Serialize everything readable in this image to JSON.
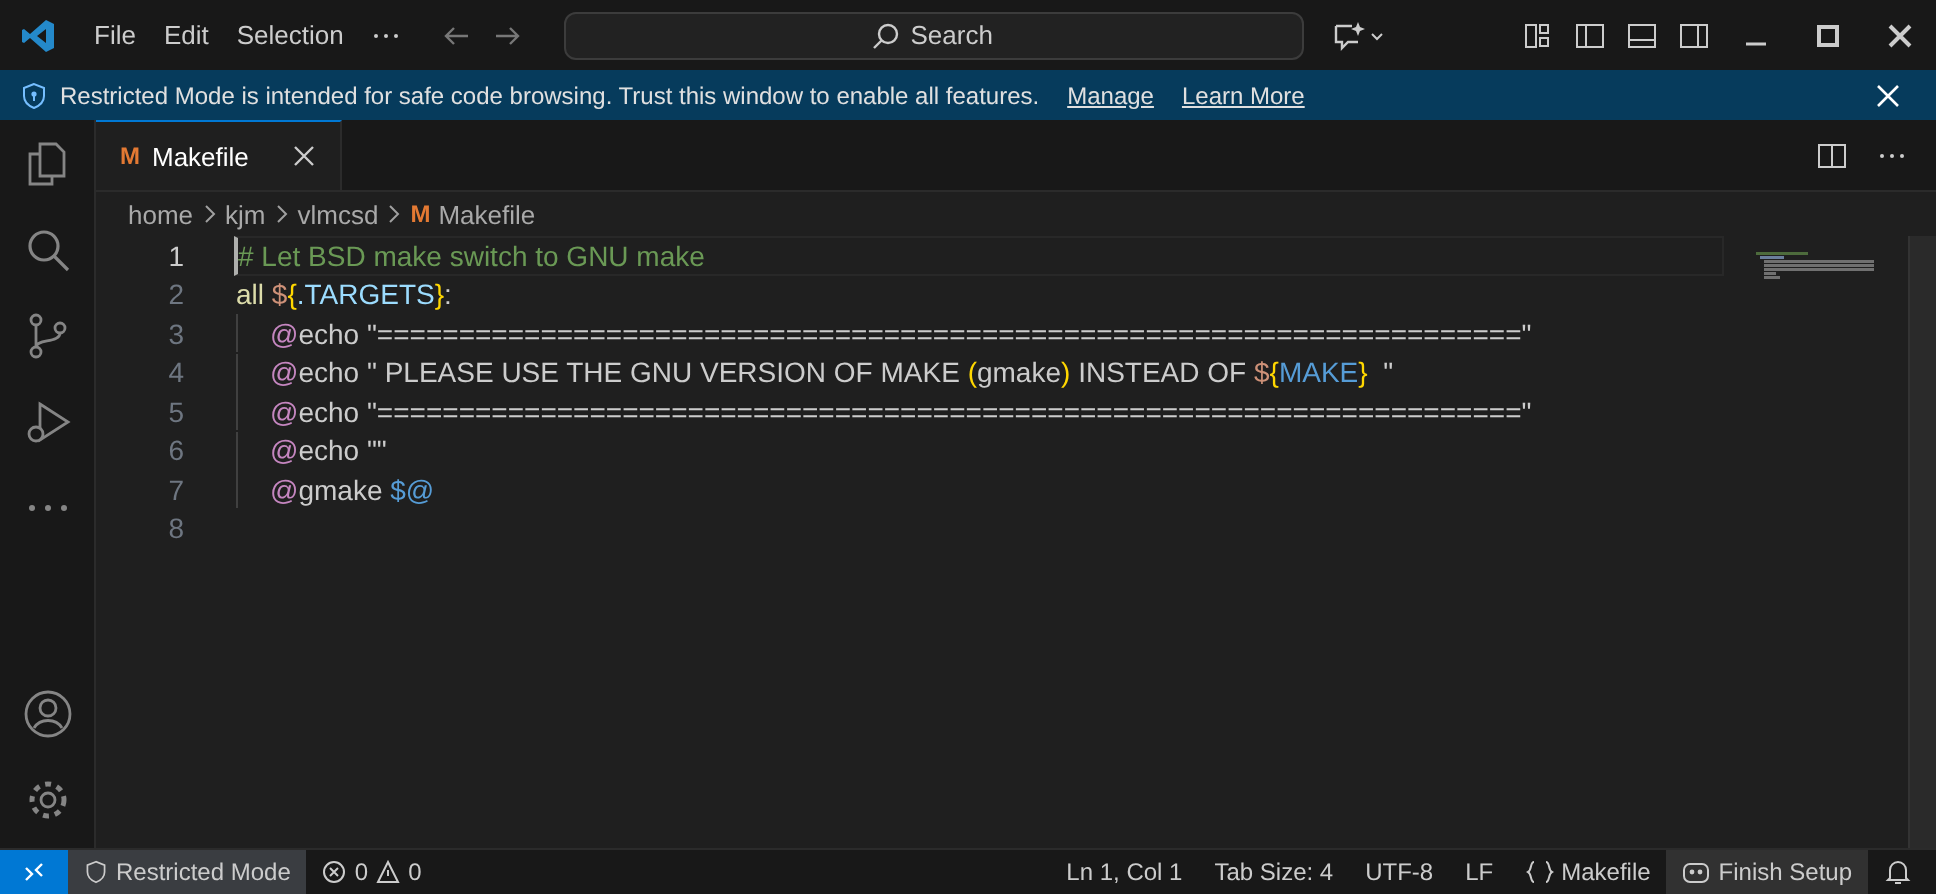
{
  "title_bar": {
    "menu": [
      "File",
      "Edit",
      "Selection"
    ],
    "search": {
      "placeholder": "Search"
    }
  },
  "banner": {
    "text": "Restricted Mode is intended for safe code browsing. Trust this window to enable all features.",
    "links": [
      "Manage",
      "Learn More"
    ]
  },
  "tabs": [
    {
      "label": "Makefile",
      "icon": "M",
      "selected": true
    }
  ],
  "breadcrumbs": [
    "home",
    "kjm",
    "vlmcsd",
    "Makefile"
  ],
  "breadcrumb_icon": "M",
  "editor": {
    "lines": [
      {
        "number": "1",
        "current": true,
        "tokens": [
          {
            "kind": "comment",
            "text": "# Let BSD make switch to GNU make"
          }
        ]
      },
      {
        "number": "2",
        "current": false,
        "tokens": [
          {
            "kind": "target",
            "text": "all "
          },
          {
            "kind": "var",
            "text": "$"
          },
          {
            "kind": "brace",
            "text": "{"
          },
          {
            "kind": "name",
            "text": ".TARGETS"
          },
          {
            "kind": "brace",
            "text": "}"
          },
          {
            "kind": "plain",
            "text": ":"
          }
        ]
      },
      {
        "number": "3",
        "current": false,
        "indented": true,
        "tokens": [
          {
            "kind": "at",
            "text": "@"
          },
          {
            "kind": "plain",
            "text": "echo \"======================================================================\""
          }
        ]
      },
      {
        "number": "4",
        "current": false,
        "indented": true,
        "tokens": [
          {
            "kind": "at",
            "text": "@"
          },
          {
            "kind": "plain",
            "text": "echo \" PLEASE USE THE GNU VERSION OF MAKE "
          },
          {
            "kind": "brace",
            "text": "("
          },
          {
            "kind": "plain",
            "text": "gmake"
          },
          {
            "kind": "brace",
            "text": ")"
          },
          {
            "kind": "plain",
            "text": " INSTEAD OF "
          },
          {
            "kind": "var",
            "text": "$"
          },
          {
            "kind": "brace",
            "text": "{"
          },
          {
            "kind": "keyname",
            "text": "MAKE"
          },
          {
            "kind": "brace",
            "text": "}"
          },
          {
            "kind": "plain",
            "text": "  \""
          }
        ]
      },
      {
        "number": "5",
        "current": false,
        "indented": true,
        "tokens": [
          {
            "kind": "at",
            "text": "@"
          },
          {
            "kind": "plain",
            "text": "echo \"======================================================================\""
          }
        ]
      },
      {
        "number": "6",
        "current": false,
        "indented": true,
        "tokens": [
          {
            "kind": "at",
            "text": "@"
          },
          {
            "kind": "plain",
            "text": "echo \"\""
          }
        ]
      },
      {
        "number": "7",
        "current": false,
        "indented": true,
        "tokens": [
          {
            "kind": "at",
            "text": "@"
          },
          {
            "kind": "plain",
            "text": "gmake "
          },
          {
            "kind": "keyname",
            "text": "$@"
          }
        ]
      },
      {
        "number": "8",
        "current": false
      }
    ]
  },
  "status_bar": {
    "restricted": "Restricted Mode",
    "errors": "0",
    "warnings": "0",
    "items": [
      "Ln 1, Col 1",
      "Tab Size: 4",
      "UTF-8",
      "LF"
    ],
    "language": "Makefile",
    "setup": "Finish Setup"
  }
}
